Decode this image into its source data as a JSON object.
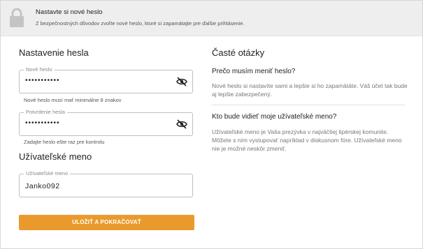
{
  "banner": {
    "title": "Nastavte si nové heslo",
    "subtitle": "Z bezpečnostných dôvodov zvoľte nové heslo, ktoré si zapamätajte pre ďalšie prihlásenie.",
    "icon": "lock-icon"
  },
  "password_section": {
    "title": "Nastavenie hesla",
    "new_password": {
      "label": "Nové heslo",
      "value": "•••••••••••",
      "hint": "Nové heslo musí mať minimálne 8 znakov",
      "toggle_icon": "eye-slash-icon"
    },
    "confirm_password": {
      "label": "Potvrdenie hesla",
      "value": "•••••••••••",
      "hint": "Zadajte heslo ešte raz pre kontrolu",
      "toggle_icon": "eye-slash-icon"
    }
  },
  "username_section": {
    "title": "Užívateľské meno",
    "username": {
      "label": "Užívateľské meno",
      "value": "Janko092"
    }
  },
  "submit": {
    "label": "ULOŽIŤ A POKRAČOVAŤ",
    "color": "#ea9a2c"
  },
  "faq": {
    "title": "Časté otázky",
    "items": [
      {
        "question": "Prečo musím meniť heslo?",
        "answer": "Nové heslo si nastavíte sami a lepšie si ho zapamätáte. Váš účet tak bude aj lepšie zabezpečený."
      },
      {
        "question": "Kto bude vidieť moje užívateľské meno?",
        "answer": "Užívateľské meno je Vaša prezývka v najväčšej tipérskej komunite. Môžete s ním vystupovať napríklad v diskusnom fóre. Užívateľské meno nie je možné neskôr zmeniť."
      }
    ]
  }
}
